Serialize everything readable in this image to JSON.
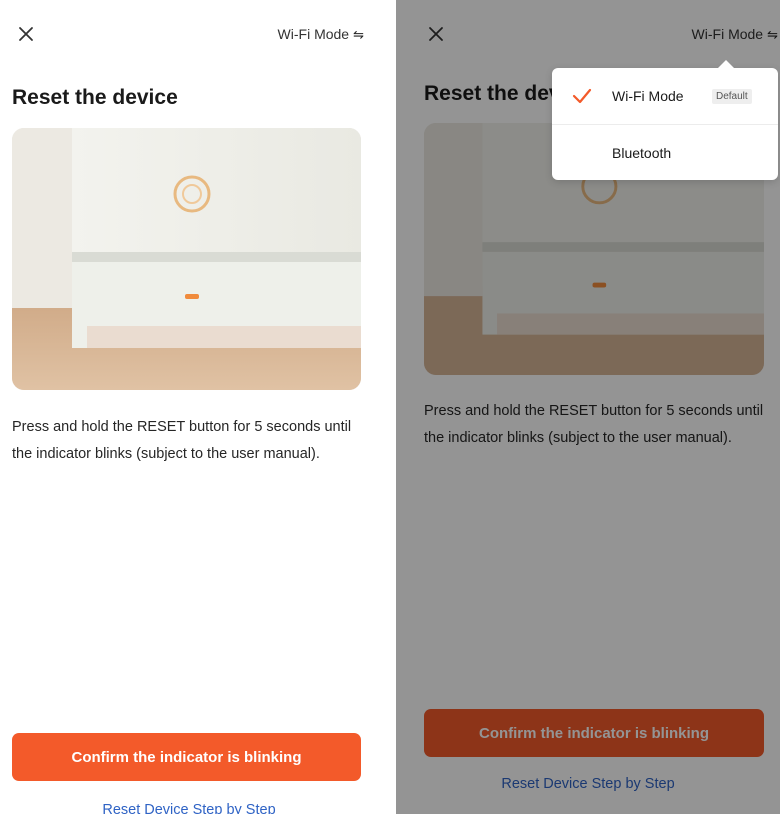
{
  "header": {
    "mode_label": "Wi-Fi Mode",
    "mode_icon": "swap-arrows-icon"
  },
  "page": {
    "title": "Reset the device",
    "instructions": "Press and hold the RESET button for 5 seconds until the indicator blinks (subject to the user manual).",
    "confirm_label": "Confirm the indicator is blinking",
    "step_link_label": "Reset Device Step by Step"
  },
  "mode_menu": {
    "items": [
      {
        "label": "Wi-Fi Mode",
        "badge": "Default",
        "selected": true
      },
      {
        "label": "Bluetooth",
        "selected": false
      }
    ]
  },
  "colors": {
    "accent": "#f35a2a",
    "link": "#2f63c5",
    "check": "#f35a2a"
  }
}
